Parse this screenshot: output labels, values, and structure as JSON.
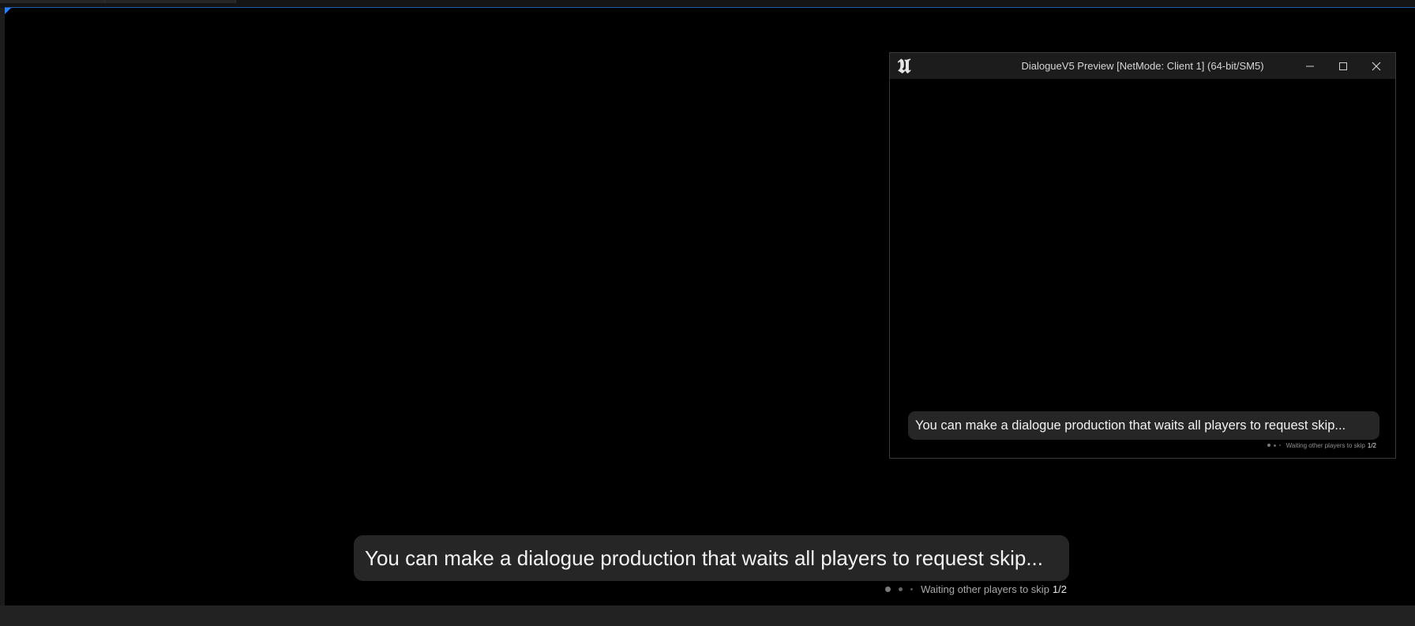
{
  "preview_window": {
    "title": "DialogueV5 Preview [NetMode: Client 1]  (64-bit/SM5)",
    "logo_icon": "unreal-engine-logo-icon",
    "controls": [
      "minimize-icon",
      "maximize-icon",
      "close-icon"
    ],
    "dialogue": {
      "text": "You can make a dialogue production that waits all players to request skip...",
      "status_text": "Waiting other players to skip",
      "skip_count": "1/2"
    }
  },
  "main_viewport": {
    "dialogue": {
      "text": "You can make a dialogue production that waits all players to request skip...",
      "status_text": "Waiting other players to skip",
      "skip_count": "1/2"
    }
  },
  "colors": {
    "accent": "#2c7ff0",
    "dialogue_box_bg": "#262626",
    "viewport_bg": "#000000"
  }
}
